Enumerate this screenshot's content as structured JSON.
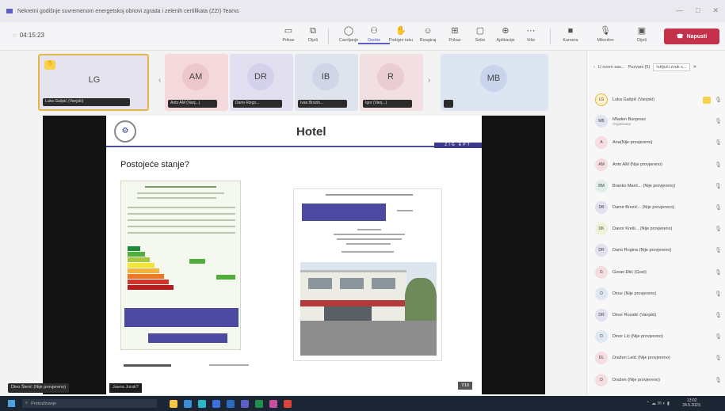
{
  "window": {
    "title": "Nekretni godišnje suvremenom energetskoj obnovi zgrada i zelenih certifikata (ZZI) Teams",
    "controls": [
      "—",
      "□",
      "✕"
    ]
  },
  "toolbar": {
    "timer": "04:15:23",
    "items": [
      {
        "label": "Prikaz",
        "icon": "view-icon"
      },
      {
        "label": "Dijeli",
        "icon": "share-icon"
      },
      {
        "label": "Čavrljanje",
        "icon": "chat-icon"
      },
      {
        "label": "Osobe",
        "icon": "people-icon",
        "active": true
      },
      {
        "label": "Podigni ruku",
        "icon": "raise-hand-icon"
      },
      {
        "label": "Reagiraj",
        "icon": "react-icon"
      },
      {
        "label": "Prikaz",
        "icon": "grid-icon"
      },
      {
        "label": "Sobe",
        "icon": "rooms-icon"
      },
      {
        "label": "Aplikacije",
        "icon": "apps-icon"
      },
      {
        "label": "Više",
        "icon": "more-icon"
      }
    ],
    "devices": [
      {
        "label": "Kamera",
        "icon": "camera-icon"
      },
      {
        "label": "Mikrofon",
        "icon": "mic-icon"
      },
      {
        "label": "Dijeli",
        "icon": "share-screen-icon"
      }
    ],
    "leave_label": "Napusti"
  },
  "tiles": [
    {
      "initials": "LG",
      "name": "Luka Gašpić (Vanjski)",
      "color": "#e4e3ee",
      "hand": true
    },
    {
      "initials": "AM",
      "name": "Anto AM (Vanj...)",
      "color": "#f3d9dc"
    },
    {
      "initials": "DR",
      "name": "Dario Rizgo...",
      "color": "#e2e0f0"
    },
    {
      "initials": "IB",
      "name": "Ivan Brezin...",
      "color": "#dfe3ee"
    },
    {
      "initials": "R",
      "name": "Igor (Vanj...)",
      "color": "#f2dfe1"
    },
    {
      "initials": "MB",
      "name": "",
      "color": "#dde4f2"
    }
  ],
  "slide": {
    "logo": "⚙",
    "title": "Hotel",
    "brand": "ZIG EPT",
    "subtitle": "Postojeće stanje?",
    "page": "7/18"
  },
  "stage": {
    "presenter": "Dino Šterić",
    "presenter_status": "(Nije provjereno)",
    "caption": "Jasna Jurak?"
  },
  "panel": {
    "title": "U ovom sas...",
    "tab": "Pozvani (5)",
    "button": "Isključi zvuk s...",
    "participants": [
      {
        "initials": "LG",
        "name": "Luka Gašpić (Vanjski)",
        "sub": "",
        "color": "#fff3c8",
        "hand": true
      },
      {
        "initials": "MB",
        "name": "Mladen Bunjevac",
        "sub": "Organizator",
        "color": "#dfe3f2"
      },
      {
        "initials": "A",
        "name": "Ana(Nije provjereno)",
        "sub": "",
        "color": "#f5dde0"
      },
      {
        "initials": "AM",
        "name": "Anto AM (Nije provjereno)",
        "sub": "",
        "color": "#f5dde0"
      },
      {
        "initials": "BM",
        "name": "Branko Marić... (Nije provjereno)",
        "sub": "",
        "color": "#dfeee9"
      },
      {
        "initials": "DB",
        "name": "Damir Brezić... (Nije provjereno)",
        "sub": "",
        "color": "#e2e0f0"
      },
      {
        "initials": "DK",
        "name": "Davor Kreši... (Nije provjereno)",
        "sub": "",
        "color": "#eef2d8"
      },
      {
        "initials": "DR",
        "name": "Dario Rogina (Nije provjereno)",
        "sub": "",
        "color": "#e2e0f0"
      },
      {
        "initials": "G",
        "name": "Goran Điić (Gost)",
        "sub": "",
        "color": "#f5dde0"
      },
      {
        "initials": "D",
        "name": "Dinur (Nije provjereno)",
        "sub": "",
        "color": "#dfe7f2"
      },
      {
        "initials": "DR",
        "name": "Dinor Rozalić (Vanjski)",
        "sub": "",
        "color": "#e2e0f0"
      },
      {
        "initials": "D",
        "name": "Dinor Lić (Nije provjereno)",
        "sub": "",
        "color": "#dfe7f2"
      },
      {
        "initials": "DL",
        "name": "Dražen Lelić (Nije provjereno)",
        "sub": "",
        "color": "#f5dde0"
      },
      {
        "initials": "D",
        "name": "Dražen (Nije provjereno)",
        "sub": "",
        "color": "#f5dde0"
      }
    ]
  },
  "taskbar": {
    "search_placeholder": "Pretraživanje",
    "time": "13:02",
    "date": "24.5.2023."
  }
}
